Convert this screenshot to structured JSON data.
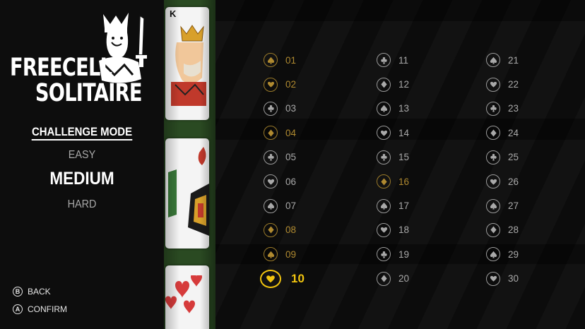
{
  "logo": {
    "line1": "FREECELL",
    "line2": "SOLITAIRE"
  },
  "mode_title": "CHALLENGE MODE",
  "difficulties": [
    {
      "label": "EASY",
      "selected": false
    },
    {
      "label": "MEDIUM",
      "selected": true
    },
    {
      "label": "HARD",
      "selected": false
    }
  ],
  "hints": [
    {
      "button": "B",
      "label": "BACK"
    },
    {
      "button": "A",
      "label": "CONFIRM"
    }
  ],
  "strip_card_rank": "K",
  "colors": {
    "gold": "#f1c40f",
    "done": "#b08a30",
    "grey": "#a9a9a9"
  },
  "challenges": [
    {
      "num": "01",
      "suit": "spade",
      "state": "done"
    },
    {
      "num": "02",
      "suit": "heart",
      "state": "done"
    },
    {
      "num": "03",
      "suit": "club",
      "state": "open"
    },
    {
      "num": "04",
      "suit": "diamond",
      "state": "done"
    },
    {
      "num": "05",
      "suit": "club",
      "state": "open"
    },
    {
      "num": "06",
      "suit": "heart",
      "state": "open"
    },
    {
      "num": "07",
      "suit": "spade",
      "state": "open"
    },
    {
      "num": "08",
      "suit": "diamond",
      "state": "done"
    },
    {
      "num": "09",
      "suit": "spade",
      "state": "done"
    },
    {
      "num": "10",
      "suit": "heart",
      "state": "current"
    },
    {
      "num": "11",
      "suit": "club",
      "state": "open"
    },
    {
      "num": "12",
      "suit": "diamond",
      "state": "open"
    },
    {
      "num": "13",
      "suit": "spade",
      "state": "open"
    },
    {
      "num": "14",
      "suit": "heart",
      "state": "open"
    },
    {
      "num": "15",
      "suit": "club",
      "state": "open"
    },
    {
      "num": "16",
      "suit": "diamond",
      "state": "done"
    },
    {
      "num": "17",
      "suit": "spade",
      "state": "open"
    },
    {
      "num": "18",
      "suit": "heart",
      "state": "open"
    },
    {
      "num": "19",
      "suit": "club",
      "state": "open"
    },
    {
      "num": "20",
      "suit": "diamond",
      "state": "open"
    },
    {
      "num": "21",
      "suit": "spade",
      "state": "open"
    },
    {
      "num": "22",
      "suit": "heart",
      "state": "open"
    },
    {
      "num": "23",
      "suit": "club",
      "state": "open"
    },
    {
      "num": "24",
      "suit": "diamond",
      "state": "open"
    },
    {
      "num": "25",
      "suit": "club",
      "state": "open"
    },
    {
      "num": "26",
      "suit": "heart",
      "state": "open"
    },
    {
      "num": "27",
      "suit": "spade",
      "state": "open"
    },
    {
      "num": "28",
      "suit": "diamond",
      "state": "open"
    },
    {
      "num": "29",
      "suit": "spade",
      "state": "open"
    },
    {
      "num": "30",
      "suit": "heart",
      "state": "open"
    }
  ]
}
